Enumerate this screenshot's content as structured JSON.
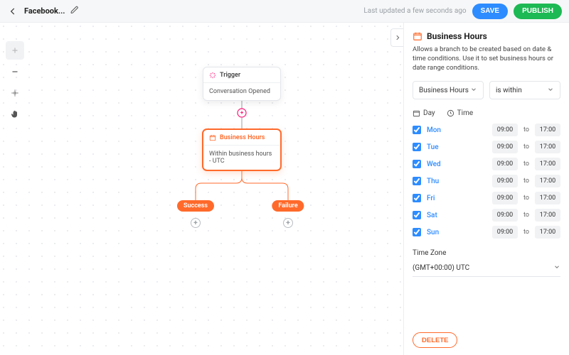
{
  "header": {
    "title": "Facebook...",
    "last_updated": "Last updated a few seconds ago",
    "save_label": "SAVE",
    "publish_label": "PUBLISH"
  },
  "canvas": {
    "trigger_node": {
      "head": "Trigger",
      "body": "Conversation Opened"
    },
    "bh_node": {
      "head": "Business Hours",
      "body": "Within business hours - UTC"
    },
    "success_pill": "Success",
    "failure_pill": "Failure"
  },
  "panel": {
    "title": "Business Hours",
    "description": "Allows a branch to be created based on date & time conditions. Use it to set business hours or date range conditions.",
    "select1": "Business Hours",
    "select2": "is within",
    "mode_day": "Day",
    "mode_time": "Time",
    "to_word": "to",
    "schedule": [
      {
        "day": "Mon",
        "checked": true,
        "from": "09:00",
        "to": "17:00"
      },
      {
        "day": "Tue",
        "checked": true,
        "from": "09:00",
        "to": "17:00"
      },
      {
        "day": "Wed",
        "checked": true,
        "from": "09:00",
        "to": "17:00"
      },
      {
        "day": "Thu",
        "checked": true,
        "from": "09:00",
        "to": "17:00"
      },
      {
        "day": "Fri",
        "checked": true,
        "from": "09:00",
        "to": "17:00"
      },
      {
        "day": "Sat",
        "checked": true,
        "from": "09:00",
        "to": "17:00"
      },
      {
        "day": "Sun",
        "checked": true,
        "from": "09:00",
        "to": "17:00"
      }
    ],
    "tz_label": "Time Zone",
    "tz_value": "(GMT+00:00) UTC",
    "delete_label": "DELETE"
  }
}
